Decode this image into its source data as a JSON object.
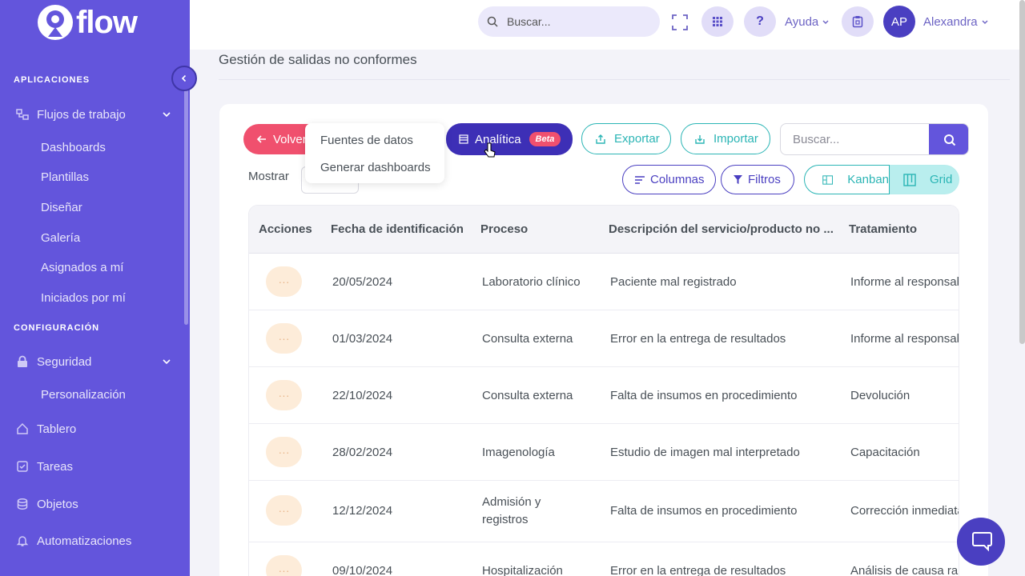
{
  "app": {
    "name": "flow"
  },
  "sidebar": {
    "sections": [
      {
        "title": "APLICACIONES"
      },
      {
        "title": "CONFIGURACIÓN"
      }
    ],
    "flujos": {
      "label": "Flujos de trabajo",
      "icon": "workflow-icon",
      "items": [
        "Dashboards",
        "Plantillas",
        "Diseñar",
        "Galería",
        "Asignados a mí",
        "Iniciados por mí"
      ]
    },
    "seguridad": {
      "label": "Seguridad",
      "icon": "lock-icon",
      "items": [
        "Personalización"
      ]
    },
    "links": [
      {
        "label": "Tablero",
        "icon": "home-icon"
      },
      {
        "label": "Tareas",
        "icon": "task-checkbox-icon"
      },
      {
        "label": "Objetos",
        "icon": "database-icon"
      },
      {
        "label": "Automatizaciones",
        "icon": "bell-icon"
      }
    ],
    "accent": "#6355dc"
  },
  "topbar": {
    "search_placeholder": "Buscar...",
    "help_label": "Ayuda",
    "avatar_initials": "AP",
    "user_name": "Alexandra"
  },
  "page": {
    "title": "Gestión de salidas no conformes",
    "toolbar": {
      "volver": "Volver",
      "analitica": "Analítica",
      "beta": "Beta",
      "exportar": "Exportar",
      "importar": "Importar",
      "search_placeholder": "Buscar...",
      "mostrar": "Mostrar",
      "columnas": "Columnas",
      "filtros": "Filtros",
      "kanban": "Kanban",
      "grid": "Grid"
    },
    "dropdown": [
      "Fuentes de datos",
      "Generar dashboards"
    ],
    "table": {
      "columns": [
        "Acciones",
        "Fecha de identificación",
        "Proceso",
        "Descripción del servicio/producto no ...",
        "Tratamiento"
      ],
      "rows": [
        {
          "action": "···",
          "fecha": "20/05/2024",
          "proceso": [
            "Laboratorio clínico"
          ],
          "descripcion": "Paciente mal registrado",
          "tratamiento": "Informe al responsab"
        },
        {
          "action": "···",
          "fecha": "01/03/2024",
          "proceso": [
            "Consulta externa"
          ],
          "descripcion": "Error en la entrega de resultados",
          "tratamiento": "Informe al responsab"
        },
        {
          "action": "···",
          "fecha": "22/10/2024",
          "proceso": [
            "Consulta externa"
          ],
          "descripcion": "Falta de insumos en procedimiento",
          "tratamiento": "Devolución"
        },
        {
          "action": "···",
          "fecha": "28/02/2024",
          "proceso": [
            "Imagenología"
          ],
          "descripcion": "Estudio de imagen mal interpretado",
          "tratamiento": "Capacitación"
        },
        {
          "action": "···",
          "fecha": "12/12/2024",
          "proceso": [
            "Admisión y",
            "registros"
          ],
          "descripcion": "Falta de insumos en procedimiento",
          "tratamiento": "Corrección inmediata"
        },
        {
          "action": "···",
          "fecha": "09/10/2024",
          "proceso": [
            "Hospitalización"
          ],
          "descripcion": "Error en la entrega de resultados",
          "tratamiento": "Análisis de causa raíz"
        }
      ]
    }
  }
}
